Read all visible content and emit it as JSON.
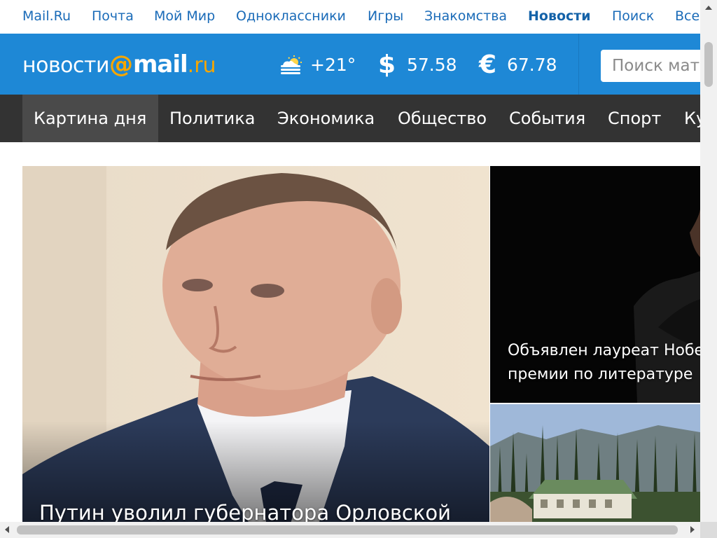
{
  "portal": {
    "links": [
      {
        "label": "Mail.Ru",
        "active": false
      },
      {
        "label": "Почта",
        "active": false
      },
      {
        "label": "Мой Мир",
        "active": false
      },
      {
        "label": "Одноклассники",
        "active": false
      },
      {
        "label": "Игры",
        "active": false
      },
      {
        "label": "Знакомства",
        "active": false
      },
      {
        "label": "Новости",
        "active": true
      },
      {
        "label": "Поиск",
        "active": false
      },
      {
        "label": "Все",
        "active": false
      }
    ]
  },
  "header": {
    "logo": {
      "word": "новости",
      "at": "@",
      "brand": "mail",
      "tld": ".ru"
    },
    "weather": {
      "icon": "partly-cloudy-icon",
      "temp": "+21°"
    },
    "usd": {
      "symbol": "$",
      "rate": "57.58"
    },
    "eur": {
      "symbol": "€",
      "rate": "67.78"
    },
    "search": {
      "placeholder": "Поиск материалов"
    }
  },
  "nav": {
    "items": [
      {
        "label": "Картина дня",
        "active": true
      },
      {
        "label": "Политика",
        "active": false
      },
      {
        "label": "Экономика",
        "active": false
      },
      {
        "label": "Общество",
        "active": false
      },
      {
        "label": "События",
        "active": false
      },
      {
        "label": "Спорт",
        "active": false
      },
      {
        "label": "Культура",
        "active": false
      }
    ]
  },
  "stories": {
    "main": {
      "headline": "Путин уволил губернатора Орловской"
    },
    "side1": {
      "headline_line1": "Объявлен лауреат Нобелевской",
      "headline_line2": "премии по литературе"
    },
    "side2": {
      "headline": ""
    }
  },
  "colors": {
    "brand_blue": "#1e88d6",
    "accent_orange": "#f7a600",
    "nav_dark": "#333333",
    "link_blue": "#1a6bb8"
  }
}
